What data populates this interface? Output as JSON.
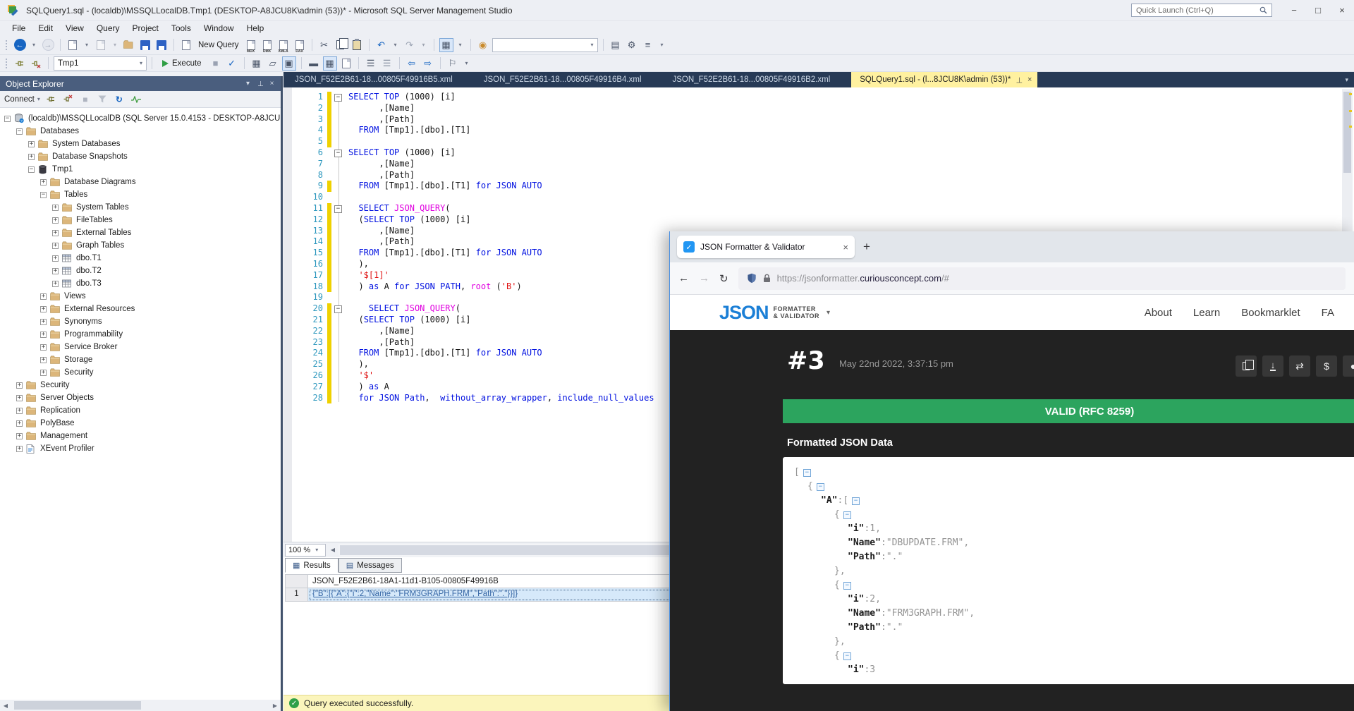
{
  "title_bar": {
    "title": "SQLQuery1.sql - (localdb)\\MSSQLLocalDB.Tmp1 (DESKTOP-A8JCU8K\\admin (53))* - Microsoft SQL Server Management Studio",
    "quick_launch": "Quick Launch (Ctrl+Q)"
  },
  "menu_items": [
    "File",
    "Edit",
    "View",
    "Query",
    "Project",
    "Tools",
    "Window",
    "Help"
  ],
  "toolbar": {
    "new_query_label": "New Query",
    "doc_buttons": [
      "MDX",
      "DMX",
      "XMLA",
      "DAX"
    ],
    "database": "Tmp1",
    "execute_label": "Execute"
  },
  "object_explorer": {
    "title": "Object Explorer",
    "connect_label": "Connect",
    "tree": [
      {
        "label": "(localdb)\\MSSQLLocalDB (SQL Server 15.0.4153 - DESKTOP-A8JCU",
        "level": 0,
        "exp": "minus",
        "icon": "server"
      },
      {
        "label": "Databases",
        "level": 1,
        "exp": "minus",
        "icon": "folder"
      },
      {
        "label": "System Databases",
        "level": 2,
        "exp": "plus",
        "icon": "folder"
      },
      {
        "label": "Database Snapshots",
        "level": 2,
        "exp": "plus",
        "icon": "folder"
      },
      {
        "label": "Tmp1",
        "level": 2,
        "exp": "minus",
        "icon": "database"
      },
      {
        "label": "Database Diagrams",
        "level": 3,
        "exp": "plus",
        "icon": "folder"
      },
      {
        "label": "Tables",
        "level": 3,
        "exp": "minus",
        "icon": "folder"
      },
      {
        "label": "System Tables",
        "level": 4,
        "exp": "plus",
        "icon": "folder"
      },
      {
        "label": "FileTables",
        "level": 4,
        "exp": "plus",
        "icon": "folder"
      },
      {
        "label": "External Tables",
        "level": 4,
        "exp": "plus",
        "icon": "folder"
      },
      {
        "label": "Graph Tables",
        "level": 4,
        "exp": "plus",
        "icon": "folder"
      },
      {
        "label": "dbo.T1",
        "level": 4,
        "exp": "plus",
        "icon": "table"
      },
      {
        "label": "dbo.T2",
        "level": 4,
        "exp": "plus",
        "icon": "table"
      },
      {
        "label": "dbo.T3",
        "level": 4,
        "exp": "plus",
        "icon": "table"
      },
      {
        "label": "Views",
        "level": 3,
        "exp": "plus",
        "icon": "folder"
      },
      {
        "label": "External Resources",
        "level": 3,
        "exp": "plus",
        "icon": "folder"
      },
      {
        "label": "Synonyms",
        "level": 3,
        "exp": "plus",
        "icon": "folder"
      },
      {
        "label": "Programmability",
        "level": 3,
        "exp": "plus",
        "icon": "folder"
      },
      {
        "label": "Service Broker",
        "level": 3,
        "exp": "plus",
        "icon": "folder"
      },
      {
        "label": "Storage",
        "level": 3,
        "exp": "plus",
        "icon": "folder"
      },
      {
        "label": "Security",
        "level": 3,
        "exp": "plus",
        "icon": "folder"
      },
      {
        "label": "Security",
        "level": 1,
        "exp": "plus",
        "icon": "folder"
      },
      {
        "label": "Server Objects",
        "level": 1,
        "exp": "plus",
        "icon": "folder"
      },
      {
        "label": "Replication",
        "level": 1,
        "exp": "plus",
        "icon": "folder"
      },
      {
        "label": "PolyBase",
        "level": 1,
        "exp": "plus",
        "icon": "folder"
      },
      {
        "label": "Management",
        "level": 1,
        "exp": "plus",
        "icon": "folder"
      },
      {
        "label": "XEvent Profiler",
        "level": 1,
        "exp": "plus",
        "icon": "xevent"
      }
    ]
  },
  "doc_tabs": [
    {
      "label": "JSON_F52E2B61-18...00805F49916B5.xml",
      "active": false
    },
    {
      "label": "JSON_F52E2B61-18...00805F49916B4.xml",
      "active": false
    },
    {
      "label": "JSON_F52E2B61-18...00805F49916B2.xml",
      "active": false
    },
    {
      "label": "SQLQuery1.sql - (l...8JCU8K\\admin (53))*",
      "active": true
    }
  ],
  "editor": {
    "lines": [
      {
        "n": 1,
        "chg": true,
        "fold": true,
        "seg": [
          [
            "k",
            "SELECT"
          ],
          [
            "p",
            " "
          ],
          [
            "k",
            "TOP"
          ],
          [
            "p",
            " (1000) [i]"
          ]
        ]
      },
      {
        "n": 2,
        "chg": true,
        "fold": false,
        "seg": [
          [
            "p",
            "      ,[Name]"
          ]
        ]
      },
      {
        "n": 3,
        "chg": true,
        "fold": false,
        "seg": [
          [
            "p",
            "      ,[Path]"
          ]
        ]
      },
      {
        "n": 4,
        "chg": true,
        "fold": false,
        "seg": [
          [
            "p",
            "  "
          ],
          [
            "k",
            "FROM"
          ],
          [
            "p",
            " [Tmp1].[dbo].[T1]"
          ]
        ]
      },
      {
        "n": 5,
        "chg": true,
        "fold": false,
        "seg": []
      },
      {
        "n": 6,
        "chg": false,
        "fold": true,
        "seg": [
          [
            "k",
            "SELECT"
          ],
          [
            "p",
            " "
          ],
          [
            "k",
            "TOP"
          ],
          [
            "p",
            " (1000) [i]"
          ]
        ]
      },
      {
        "n": 7,
        "chg": false,
        "fold": false,
        "seg": [
          [
            "p",
            "      ,[Name]"
          ]
        ]
      },
      {
        "n": 8,
        "chg": false,
        "fold": false,
        "seg": [
          [
            "p",
            "      ,[Path]"
          ]
        ]
      },
      {
        "n": 9,
        "chg": true,
        "fold": false,
        "seg": [
          [
            "p",
            "  "
          ],
          [
            "k",
            "FROM"
          ],
          [
            "p",
            " [Tmp1].[dbo].[T1] "
          ],
          [
            "k",
            "for JSON AUTO"
          ]
        ]
      },
      {
        "n": 10,
        "chg": false,
        "fold": false,
        "seg": []
      },
      {
        "n": 11,
        "chg": true,
        "fold": true,
        "seg": [
          [
            "p",
            "  "
          ],
          [
            "k",
            "SELECT"
          ],
          [
            "p",
            " "
          ],
          [
            "f",
            "JSON_QUERY"
          ],
          [
            "p",
            "("
          ]
        ]
      },
      {
        "n": 12,
        "chg": true,
        "fold": false,
        "seg": [
          [
            "p",
            "  ("
          ],
          [
            "k",
            "SELECT"
          ],
          [
            "p",
            " "
          ],
          [
            "k",
            "TOP"
          ],
          [
            "p",
            " (1000) [i]"
          ]
        ]
      },
      {
        "n": 13,
        "chg": true,
        "fold": false,
        "seg": [
          [
            "p",
            "      ,[Name]"
          ]
        ]
      },
      {
        "n": 14,
        "chg": true,
        "fold": false,
        "seg": [
          [
            "p",
            "      ,[Path]"
          ]
        ]
      },
      {
        "n": 15,
        "chg": true,
        "fold": false,
        "seg": [
          [
            "p",
            "  "
          ],
          [
            "k",
            "FROM"
          ],
          [
            "p",
            " [Tmp1].[dbo].[T1] "
          ],
          [
            "k",
            "for JSON AUTO"
          ]
        ]
      },
      {
        "n": 16,
        "chg": true,
        "fold": false,
        "seg": [
          [
            "p",
            "  ),"
          ]
        ]
      },
      {
        "n": 17,
        "chg": true,
        "fold": false,
        "seg": [
          [
            "p",
            "  "
          ],
          [
            "s",
            "'$[1]'"
          ]
        ]
      },
      {
        "n": 18,
        "chg": true,
        "fold": false,
        "seg": [
          [
            "p",
            "  ) "
          ],
          [
            "k",
            "as"
          ],
          [
            "p",
            " A "
          ],
          [
            "k",
            "for JSON PATH"
          ],
          [
            "p",
            ", "
          ],
          [
            "f",
            "root"
          ],
          [
            "p",
            " ("
          ],
          [
            "s",
            "'B'"
          ],
          [
            "p",
            ")"
          ]
        ]
      },
      {
        "n": 19,
        "chg": false,
        "fold": false,
        "seg": []
      },
      {
        "n": 20,
        "chg": true,
        "fold": true,
        "seg": [
          [
            "p",
            "    "
          ],
          [
            "k",
            "SELECT"
          ],
          [
            "p",
            " "
          ],
          [
            "f",
            "JSON_QUERY"
          ],
          [
            "p",
            "("
          ]
        ]
      },
      {
        "n": 21,
        "chg": true,
        "fold": false,
        "seg": [
          [
            "p",
            "  ("
          ],
          [
            "k",
            "SELECT"
          ],
          [
            "p",
            " "
          ],
          [
            "k",
            "TOP"
          ],
          [
            "p",
            " (1000) [i]"
          ]
        ]
      },
      {
        "n": 22,
        "chg": true,
        "fold": false,
        "seg": [
          [
            "p",
            "      ,[Name]"
          ]
        ]
      },
      {
        "n": 23,
        "chg": true,
        "fold": false,
        "seg": [
          [
            "p",
            "      ,[Path]"
          ]
        ]
      },
      {
        "n": 24,
        "chg": true,
        "fold": false,
        "seg": [
          [
            "p",
            "  "
          ],
          [
            "k",
            "FROM"
          ],
          [
            "p",
            " [Tmp1].[dbo].[T1] "
          ],
          [
            "k",
            "for JSON AUTO"
          ]
        ]
      },
      {
        "n": 25,
        "chg": true,
        "fold": false,
        "seg": [
          [
            "p",
            "  ),"
          ]
        ]
      },
      {
        "n": 26,
        "chg": true,
        "fold": false,
        "seg": [
          [
            "p",
            "  "
          ],
          [
            "s",
            "'$'"
          ]
        ]
      },
      {
        "n": 27,
        "chg": true,
        "fold": false,
        "seg": [
          [
            "p",
            "  ) "
          ],
          [
            "k",
            "as"
          ],
          [
            "p",
            " A"
          ]
        ]
      },
      {
        "n": 28,
        "chg": true,
        "fold": false,
        "seg": [
          [
            "p",
            "  "
          ],
          [
            "k",
            "for"
          ],
          [
            "p",
            " "
          ],
          [
            "k",
            "JSON"
          ],
          [
            "p",
            " "
          ],
          [
            "k",
            "Path"
          ],
          [
            "p",
            ",  "
          ],
          [
            "k",
            "without_array_wrapper"
          ],
          [
            "p",
            ", "
          ],
          [
            "k",
            "include_null_values"
          ]
        ]
      }
    ]
  },
  "results_pane": {
    "zoom": "100 %",
    "tabs": [
      {
        "label": "Results",
        "active": true
      },
      {
        "label": "Messages",
        "active": false
      }
    ],
    "column_header": "JSON_F52E2B61-18A1-11d1-B105-00805F49916B",
    "row_number": "1",
    "row_value": "{\"B\":[{\"A\":{\"i\":2,\"Name\":\"FRM3GRAPH.FRM\",\"Path\":\".\"}}]}"
  },
  "status_bar": {
    "text": "Query executed successfully."
  },
  "browser": {
    "tab_title": "JSON Formatter & Validator",
    "url_prefix": "https://jsonformatter.",
    "url_domain": "curiousconcept.com",
    "url_suffix": "/#",
    "logo_word": "JSON",
    "logo_line1": "FORMATTER",
    "logo_line2": "& VALIDATOR",
    "nav": [
      "About",
      "Learn",
      "Bookmarklet",
      "FA"
    ],
    "entry_number": "#3",
    "timestamp": "May 22nd 2022, 3:37:15 pm",
    "banner": "VALID (RFC 8259)",
    "section_title": "Formatted JSON Data",
    "accent_green": "#2CA45E",
    "json_lines": [
      {
        "ind": 0,
        "box": true,
        "seg": [
          [
            "v",
            "["
          ]
        ]
      },
      {
        "ind": 1,
        "box": true,
        "seg": [
          [
            "v",
            "{"
          ]
        ]
      },
      {
        "ind": 2,
        "box": true,
        "seg": [
          [
            "k",
            "\"A\""
          ],
          [
            "v",
            ":["
          ]
        ]
      },
      {
        "ind": 3,
        "box": true,
        "seg": [
          [
            "v",
            "{"
          ]
        ]
      },
      {
        "ind": 4,
        "box": false,
        "seg": [
          [
            "k",
            "\"i\""
          ],
          [
            "v",
            ":1,"
          ]
        ]
      },
      {
        "ind": 4,
        "box": false,
        "seg": [
          [
            "k",
            "\"Name\""
          ],
          [
            "v",
            ":\"DBUPDATE.FRM\","
          ]
        ]
      },
      {
        "ind": 4,
        "box": false,
        "seg": [
          [
            "k",
            "\"Path\""
          ],
          [
            "v",
            ":\".\""
          ]
        ]
      },
      {
        "ind": 3,
        "box": false,
        "seg": [
          [
            "v",
            "},"
          ]
        ]
      },
      {
        "ind": 3,
        "box": true,
        "seg": [
          [
            "v",
            "{"
          ]
        ]
      },
      {
        "ind": 4,
        "box": false,
        "seg": [
          [
            "k",
            "\"i\""
          ],
          [
            "v",
            ":2,"
          ]
        ]
      },
      {
        "ind": 4,
        "box": false,
        "seg": [
          [
            "k",
            "\"Name\""
          ],
          [
            "v",
            ":\"FRM3GRAPH.FRM\","
          ]
        ]
      },
      {
        "ind": 4,
        "box": false,
        "seg": [
          [
            "k",
            "\"Path\""
          ],
          [
            "v",
            ":\".\""
          ]
        ]
      },
      {
        "ind": 3,
        "box": false,
        "seg": [
          [
            "v",
            "},"
          ]
        ]
      },
      {
        "ind": 3,
        "box": true,
        "seg": [
          [
            "v",
            "{"
          ]
        ]
      },
      {
        "ind": 4,
        "box": false,
        "seg": [
          [
            "k",
            "\"i\""
          ],
          [
            "v",
            ":3"
          ]
        ]
      }
    ]
  }
}
